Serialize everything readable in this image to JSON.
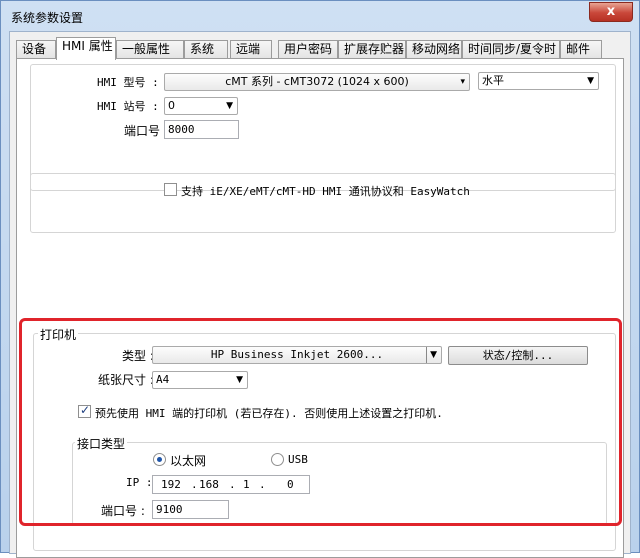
{
  "window": {
    "title": "系统参数设置",
    "close_label": "x"
  },
  "tabs": [
    "设备",
    "HMI 属性",
    "一般属性",
    "系统",
    "远端",
    "用户密码",
    "扩展存贮器",
    "移动网络",
    "时间同步/夏令时",
    "邮件"
  ],
  "active_tab": "HMI 属性",
  "hmi": {
    "model_label": "HMI 型号 :",
    "model_value": "cMT 系列 - cMT3072 (1024 x 600)",
    "orientation_value": "水平",
    "station_label": "HMI 站号 :",
    "station_value": "0",
    "port_label": "端口号 :",
    "port_value": "8000"
  },
  "support": {
    "label": "支持 iE/XE/eMT/cMT-HD HMI 通讯协议和 EasyWatch",
    "checked": false
  },
  "printer": {
    "group_title": "打印机",
    "type_label": "类型 :",
    "type_value": "HP Business Inkjet 2600...",
    "status_button": "状态/控制...",
    "paper_label": "纸张尺寸 :",
    "paper_value": "A4",
    "prefer_hmi_label": "预先使用 HMI 端的打印机 (若已存在). 否则使用上述设置之打印机.",
    "prefer_hmi_checked": true,
    "interface": {
      "title": "接口类型",
      "ethernet_label": "以太网",
      "usb_label": "USB",
      "selected": "以太网",
      "ip_label": "IP :",
      "ip": [
        "192",
        "168",
        "1",
        "0"
      ],
      "port_label": "端口号 :",
      "port_value": "9100"
    }
  },
  "colors": {
    "highlight_border": "#e0242b",
    "title_bar": "#b9d1ec"
  }
}
